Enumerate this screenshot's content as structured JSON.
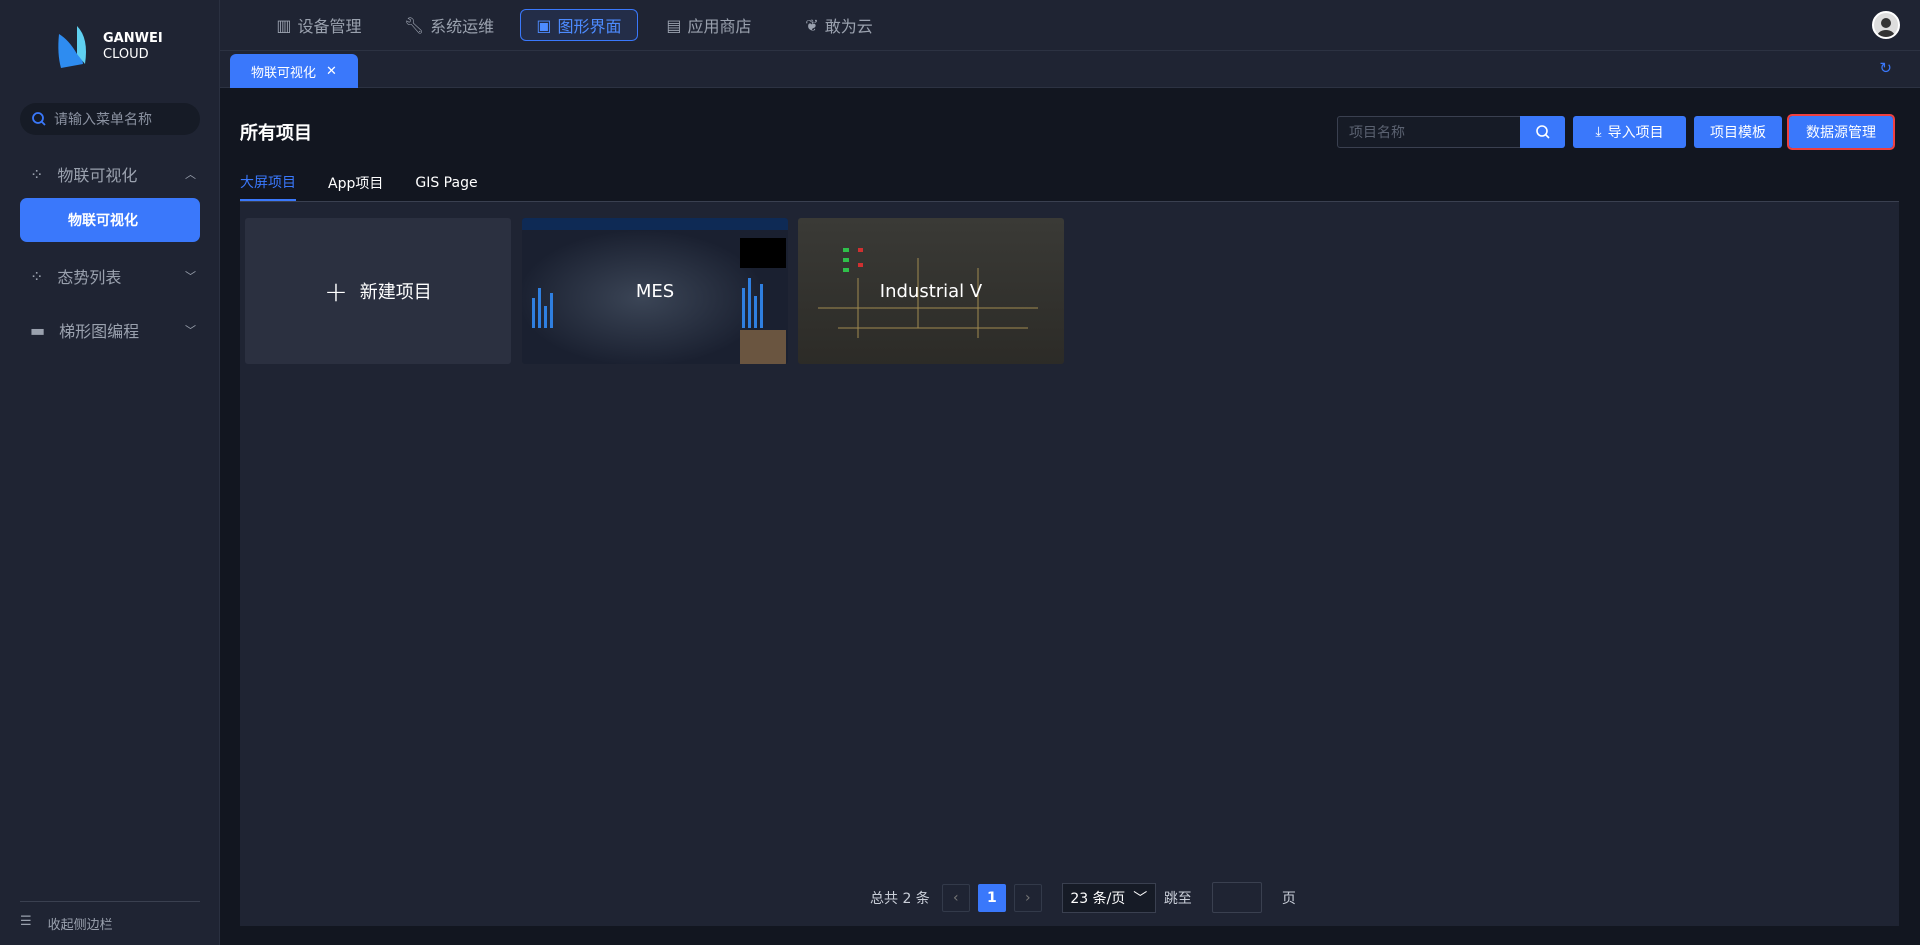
{
  "brand": {
    "line1": "GANWEI",
    "line2": "CLOUD"
  },
  "sidebar": {
    "search_placeholder": "请输入菜单名称",
    "items": [
      {
        "label": "物联可视化",
        "icon": "grid-icon",
        "expanded": true,
        "children": [
          {
            "label": "物联可视化",
            "active": true
          }
        ]
      },
      {
        "label": "态势列表",
        "icon": "grid-icon"
      },
      {
        "label": "梯形图编程",
        "icon": "ladder-icon"
      }
    ],
    "collapse_label": "收起侧边栏"
  },
  "topnav": [
    {
      "label": "设备管理",
      "icon": "device-icon"
    },
    {
      "label": "系统运维",
      "icon": "wrench-icon"
    },
    {
      "label": "图形界面",
      "icon": "monitor-icon",
      "active": true
    },
    {
      "label": "应用商店",
      "icon": "store-icon"
    },
    {
      "label": "敢为云",
      "icon": "cloud-icon"
    }
  ],
  "tabs": [
    {
      "label": "物联可视化",
      "closable": true
    }
  ],
  "main": {
    "title": "所有项目",
    "search_placeholder": "项目名称",
    "import_label": "导入项目",
    "template_label": "项目模板",
    "datasource_label": "数据源管理",
    "project_tabs": [
      {
        "label": "大屏项目",
        "active": true
      },
      {
        "label": "App项目"
      },
      {
        "label": "GIS Page"
      }
    ],
    "new_project_label": "新建项目",
    "projects": [
      {
        "name": "MES"
      },
      {
        "name": "Industrial V"
      }
    ]
  },
  "pagination": {
    "total_label": "总共 2 条",
    "current_page": "1",
    "page_size": "23 条/页",
    "jump_label": "跳至",
    "page_suffix": "页"
  },
  "colors": {
    "accent": "#3a78fb",
    "highlight": "#ef4040"
  }
}
